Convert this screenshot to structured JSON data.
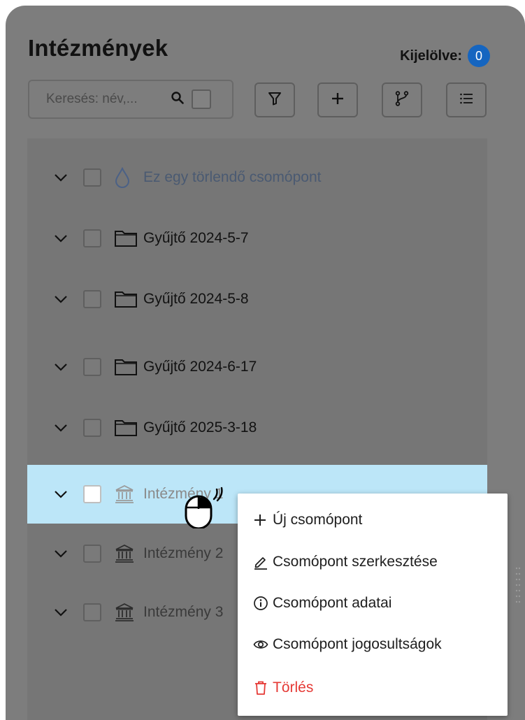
{
  "header": {
    "title": "Intézmények",
    "selected_label": "Kijelölve:",
    "selected_count": "0"
  },
  "search": {
    "placeholder": "Keresés: név,..."
  },
  "toolbar": {
    "buttons": [
      {
        "icon": "filter-icon"
      },
      {
        "icon": "plus-icon"
      },
      {
        "icon": "branch-icon"
      },
      {
        "icon": "list-icon"
      }
    ]
  },
  "tree": {
    "items": [
      {
        "label": "Ez egy törlendő csomópont",
        "icon": "drop-icon",
        "state": "deleted"
      },
      {
        "label": "Gyűjtő 2024-5-7",
        "icon": "folder-icon",
        "state": "normal"
      },
      {
        "label": "Gyűjtő 2024-5-8",
        "icon": "folder-icon",
        "state": "normal"
      },
      {
        "label": "Gyűjtő 2024-6-17",
        "icon": "folder-icon",
        "state": "normal"
      },
      {
        "label": "Gyűjtő 2025-3-18",
        "icon": "folder-icon",
        "state": "normal"
      },
      {
        "label": "Intézmény 1",
        "icon": "institution-icon",
        "state": "selected"
      },
      {
        "label": "Intézmény 2",
        "icon": "institution-icon",
        "state": "dim"
      },
      {
        "label": "Intézmény 3",
        "icon": "institution-icon",
        "state": "dim"
      }
    ]
  },
  "context_menu": {
    "items": [
      {
        "label": "Új csomópont",
        "icon": "plus-icon"
      },
      {
        "label": "Csomópont szerkesztése",
        "icon": "pencil-icon"
      },
      {
        "label": "Csomópont adatai",
        "icon": "info-icon"
      },
      {
        "label": "Csomópont jogosultságok",
        "icon": "eye-icon"
      },
      {
        "label": "Törlés",
        "icon": "trash-icon",
        "danger": true
      }
    ]
  },
  "colors": {
    "accent": "#1565c0",
    "selected_row": "#bce6f8",
    "danger": "#e53935",
    "overlay": "#7d7d7d"
  }
}
